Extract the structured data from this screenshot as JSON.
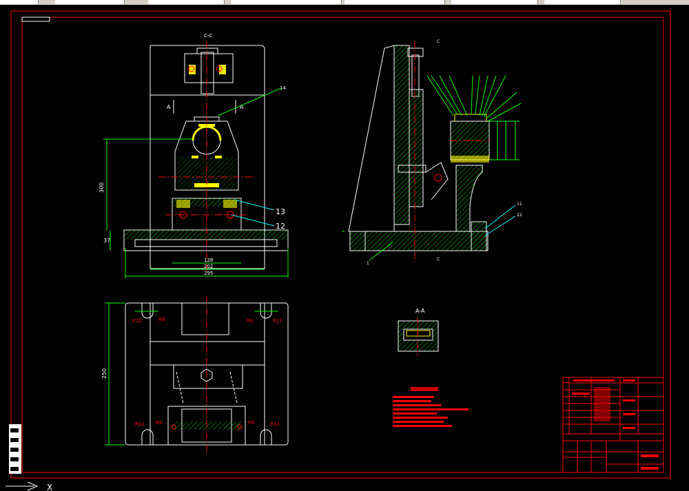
{
  "section_labels": {
    "cc": "C-C",
    "aa": "A-A",
    "sec_a_left": "A",
    "sec_a_right": "A",
    "sec_c_top": "C",
    "sec_c_bottom": "C"
  },
  "dimensions": {
    "height_300": "300",
    "base_37": "37",
    "w_128": "128",
    "w_202": "202",
    "w_295": "295",
    "h_250": "250",
    "r12_tl": "R12",
    "r6_tl": "R6",
    "r6_tr": "R6",
    "r12_tr": "R12",
    "r12_bl": "R12",
    "r6_bl": "R6",
    "r6_br": "R6",
    "r12_br": "R12"
  },
  "balloons": {
    "b14": "14",
    "b13": "13",
    "b12": "12",
    "b1": "1",
    "b11": "11",
    "b12r": "12"
  },
  "axis": {
    "x_label": "X"
  },
  "colors": {
    "frame": "#ff0000",
    "lines": "#ffffff",
    "hatch": "#00ff00",
    "center": "#ff0000",
    "dim": "#00ff00",
    "leader": "#00ffff",
    "highlight": "#ffff00"
  }
}
